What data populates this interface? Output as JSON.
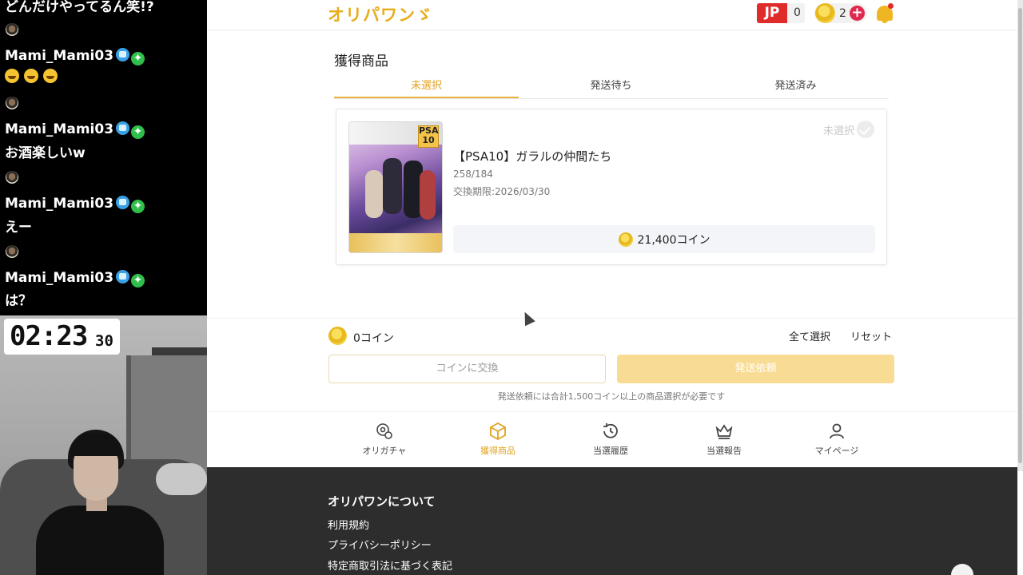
{
  "stream": {
    "chat_top_text": "どんだけやってるん笑!?",
    "chat": [
      {
        "name": "Mami_Mami03",
        "message": "🤣🤣🤣"
      },
      {
        "name": "Mami_Mami03",
        "message": "お酒楽しいw"
      },
      {
        "name": "Mami_Mami03",
        "message": "えー"
      },
      {
        "name": "Mami_Mami03",
        "message": "は？"
      }
    ],
    "timer_main": "02:23",
    "timer_sub": "30"
  },
  "header": {
    "logo": "オリパワン",
    "region": "JP",
    "region_count": "0",
    "coin_balance": "2"
  },
  "section_title": "獲得商品",
  "tabs": [
    {
      "label": "未選択",
      "active": true
    },
    {
      "label": "発送待ち",
      "active": false
    },
    {
      "label": "発送済み",
      "active": false
    }
  ],
  "product": {
    "status": "未選択",
    "name": "【PSA10】ガラルの仲間たち",
    "number": "258/184",
    "deadline": "交換期限:2026/03/30",
    "price": "21,400コイン",
    "card_grade": "PSA",
    "card_grade_num": "10"
  },
  "selection": {
    "total": "0コイン",
    "select_all": "全て選択",
    "reset": "リセット",
    "exchange_button": "コインに交換",
    "ship_button": "発送依頼",
    "note": "発送依頼には合計1,500コイン以上の商品選択が必要です"
  },
  "bottom_nav": [
    {
      "label": "オリガチャ",
      "icon": "gacha-icon"
    },
    {
      "label": "獲得商品",
      "icon": "box-icon",
      "active": true
    },
    {
      "label": "当選履歴",
      "icon": "history-icon"
    },
    {
      "label": "当選報告",
      "icon": "crown-icon"
    },
    {
      "label": "マイページ",
      "icon": "user-icon"
    }
  ],
  "footer": {
    "title": "オリパワンについて",
    "links": [
      "利用規約",
      "プライバシーポリシー",
      "特定商取引法に基づく表記"
    ]
  },
  "colors": {
    "accent": "#e0a21f",
    "footer_bg": "#2d2d2d",
    "ship_button_bg": "#f8dc94",
    "region_red": "#e02b2b"
  }
}
